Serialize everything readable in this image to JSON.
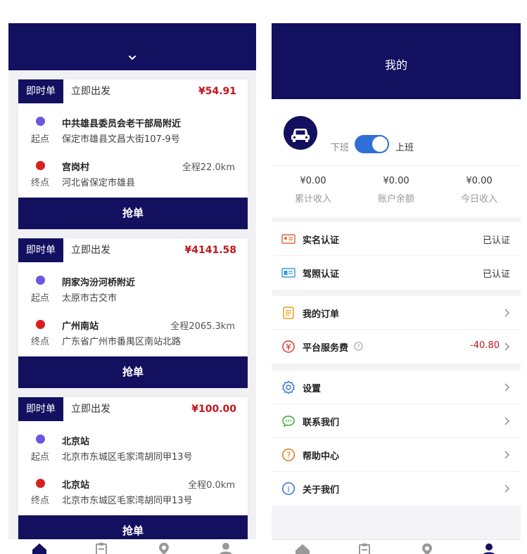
{
  "orders_screen": {
    "orders": [
      {
        "type_badge": "即时单",
        "depart": "立即出发",
        "price": "¥54.91",
        "start_name": "中共雄县委员会老干部局附近",
        "start_label": "起点",
        "start_addr": "保定市雄县文昌大街107-9号",
        "end_name": "宫岗村",
        "distance": "全程22.0km",
        "end_label": "终点",
        "end_addr": "河北省保定市雄县",
        "button": "抢单"
      },
      {
        "type_badge": "即时单",
        "depart": "立即出发",
        "price": "¥4141.58",
        "start_name": "阴家沟汾河桥附近",
        "start_label": "起点",
        "start_addr": "太原市古交市",
        "end_name": "广州南站",
        "distance": "全程2065.3km",
        "end_label": "终点",
        "end_addr": "广东省广州市番禺区南站北路",
        "button": "抢单"
      },
      {
        "type_badge": "即时单",
        "depart": "立即出发",
        "price": "¥100.00",
        "start_name": "北京站",
        "start_label": "起点",
        "start_addr": "北京市东城区毛家湾胡同甲13号",
        "end_name": "北京站",
        "distance": "全程0.0km",
        "end_label": "终点",
        "end_addr": "北京市东城区毛家湾胡同甲13号",
        "button": "抢单"
      }
    ]
  },
  "profile_screen": {
    "title": "我的",
    "off_duty": "下班",
    "on_duty": "上班",
    "duty_on": true,
    "stats": [
      {
        "value": "¥0.00",
        "label": "累计收入"
      },
      {
        "value": "¥0.00",
        "label": "账户余额"
      },
      {
        "value": "¥0.00",
        "label": "今日收入"
      }
    ],
    "verify": [
      {
        "label": "实名认证",
        "status": "已认证",
        "icon": "id-card-icon"
      },
      {
        "label": "驾照认证",
        "status": "已认证",
        "icon": "license-icon"
      }
    ],
    "orders_menu": [
      {
        "label": "我的订单",
        "icon": "order-list-icon"
      },
      {
        "label": "平台服务费",
        "value": "-40.80",
        "icon": "yuan-coin-icon"
      }
    ],
    "menu": [
      {
        "label": "设置",
        "icon": "gear-icon"
      },
      {
        "label": "联系我们",
        "icon": "chat-icon"
      },
      {
        "label": "帮助中心",
        "icon": "help-icon"
      },
      {
        "label": "关于我们",
        "icon": "info-icon"
      }
    ]
  },
  "colors": {
    "primary": "#12105f",
    "price_red": "#c1161c",
    "start_dot": "#6a57e0",
    "end_dot": "#d91f1f",
    "toggle_blue": "#2f6fd6"
  }
}
